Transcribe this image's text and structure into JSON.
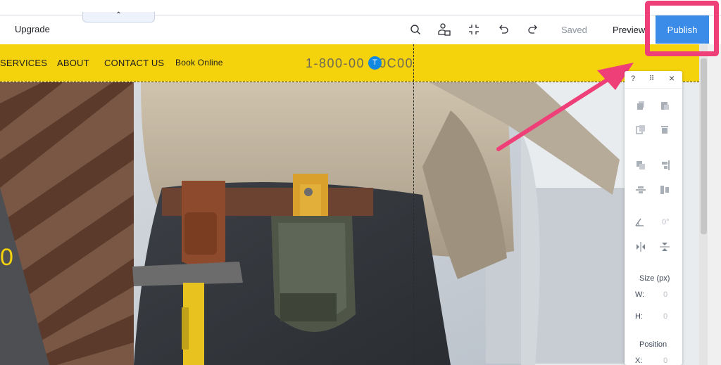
{
  "topbar": {
    "collapse_glyph": "⌃",
    "upgrade_label": "Upgrade",
    "saved_label": "Saved",
    "preview_label": "Preview",
    "publish_label": "Publish",
    "icons": [
      "search-icon",
      "accessibility-icon",
      "fit-to-screen-icon",
      "undo-icon",
      "redo-icon"
    ]
  },
  "site": {
    "nav_items": [
      "SERVICES",
      "ABOUT",
      "CONTACT US",
      "Book Online"
    ],
    "phone_left": "1-800-00",
    "phone_right": "0C00",
    "badge_letter": "T",
    "hero_number": "0"
  },
  "panel": {
    "help_label": "?",
    "drag_label": "⠿",
    "close_label": "×",
    "rotation_value": "0°",
    "size_heading": "Size (px)",
    "width_label": "W:",
    "width_value": "0",
    "height_label": "H:",
    "height_value": "0",
    "position_heading": "Position",
    "x_label": "X:",
    "x_value": "0"
  },
  "colors": {
    "accent_blue": "#3b8be8",
    "highlight_pink": "#ef3f78",
    "nav_yellow": "#f5d30c"
  }
}
